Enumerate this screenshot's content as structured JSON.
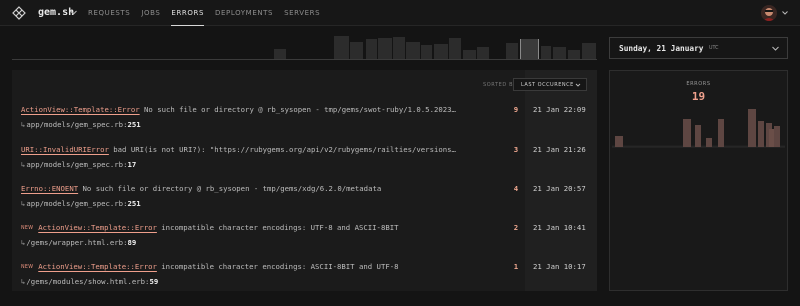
{
  "nav": {
    "app_name": "gem.sh",
    "items": [
      {
        "label": "REQUESTS",
        "active": false
      },
      {
        "label": "JOBS",
        "active": false
      },
      {
        "label": "ERRORS",
        "active": true
      },
      {
        "label": "DEPLOYMENTS",
        "active": false
      },
      {
        "label": "SERVERS",
        "active": false
      }
    ]
  },
  "errors_list": {
    "sorted_by_label": "SORTED BY",
    "sort_option": "LAST OCCURENCE",
    "rows": [
      {
        "new": false,
        "exception": "ActionView::Template::Error",
        "message": " No such file or directory @ rb_sysopen - tmp/gems/swot-ruby/1.0.5.2023…",
        "path": "app/models/gem_spec.rb",
        "line": "251",
        "count": "9",
        "time": "21 Jan 22:09"
      },
      {
        "new": false,
        "exception": "URI::InvalidURIError",
        "message": " bad URI(is not URI?): \"https://rubygems.org/api/v2/rubygems/railties/versions…",
        "path": "app/models/gem_spec.rb",
        "line": "17",
        "count": "3",
        "time": "21 Jan 21:26"
      },
      {
        "new": false,
        "exception": "Errno::ENOENT",
        "message": " No such file or directory @ rb_sysopen - tmp/gems/xdg/6.2.0/metadata",
        "path": "app/models/gem_spec.rb",
        "line": "251",
        "count": "4",
        "time": "21 Jan 20:57"
      },
      {
        "new": true,
        "new_label": "NEW",
        "exception": "ActionView::Template::Error",
        "message": " incompatible character encodings: UTF-8 and ASCII-8BIT",
        "path": "/gems/wrapper.html.erb",
        "line": "89",
        "count": "2",
        "time": "21 Jan 10:41"
      },
      {
        "new": true,
        "new_label": "NEW",
        "exception": "ActionView::Template::Error",
        "message": " incompatible character encodings: ASCII-8BIT and UTF-8",
        "path": "/gems/modules/show.html.erb",
        "line": "59",
        "count": "1",
        "time": "21 Jan 10:17"
      }
    ]
  },
  "date_picker": {
    "value": "Sunday, 21 January",
    "timezone": "UTC"
  },
  "errors_chart": {
    "label": "ERRORS",
    "total": "19"
  },
  "colors": {
    "accent": "#ef9f8c",
    "background": "#141414",
    "panel": "#1b1b1b"
  },
  "icons": {
    "logo": "gem-logo-icon",
    "chevron": "chevron-down-icon",
    "avatar": "user-avatar"
  }
}
